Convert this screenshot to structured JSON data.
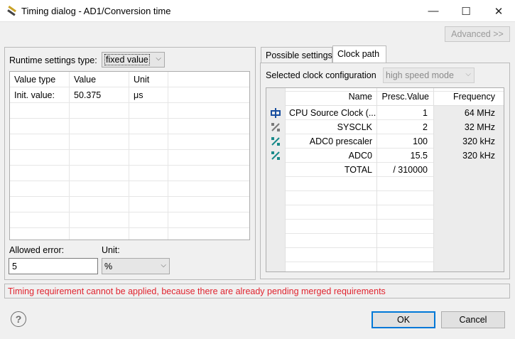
{
  "window": {
    "title": "Timing dialog - AD1/Conversion time",
    "minimize_glyph": "—",
    "maximize_glyph": "☐",
    "close_glyph": "✕"
  },
  "advanced_button": "Advanced >>",
  "runtime": {
    "label": "Runtime settings type:",
    "selected": "fixed value",
    "columns": [
      "Value type",
      "Value",
      "Unit"
    ],
    "rows": [
      {
        "type": "Init. value:",
        "value": "50.375",
        "unit": "μs"
      }
    ]
  },
  "allowed_error": {
    "label": "Allowed error:",
    "value": "5",
    "unit_label": "Unit:",
    "unit_value": "%"
  },
  "tabs": [
    "Possible settings",
    "Clock path"
  ],
  "clock": {
    "config_label": "Selected clock configuration",
    "config_value": "high speed mode",
    "columns": [
      "Name",
      "Presc.Value",
      "Frequency"
    ],
    "rows": [
      {
        "icon": "clock-source-icon",
        "name": "CPU Source Clock (...",
        "presc": "1",
        "freq": "64 MHz"
      },
      {
        "icon": "divider-gray-icon",
        "name": "SYSCLK",
        "presc": "2",
        "freq": "32 MHz"
      },
      {
        "icon": "divider-teal-icon",
        "name": "ADC0 prescaler",
        "presc": "100",
        "freq": "320 kHz"
      },
      {
        "icon": "divider-teal-icon",
        "name": "ADC0",
        "presc": "15.5",
        "freq": "320 kHz"
      },
      {
        "icon": "",
        "name": "TOTAL",
        "presc": "/ 310000",
        "freq": ""
      }
    ]
  },
  "error_message": "Timing requirement cannot be applied, because there are already pending merged requirements",
  "buttons": {
    "ok": "OK",
    "cancel": "Cancel",
    "help": "?"
  },
  "colors": {
    "error": "#e0242f",
    "accent": "#0078d7",
    "teal": "#1a8a8a"
  }
}
